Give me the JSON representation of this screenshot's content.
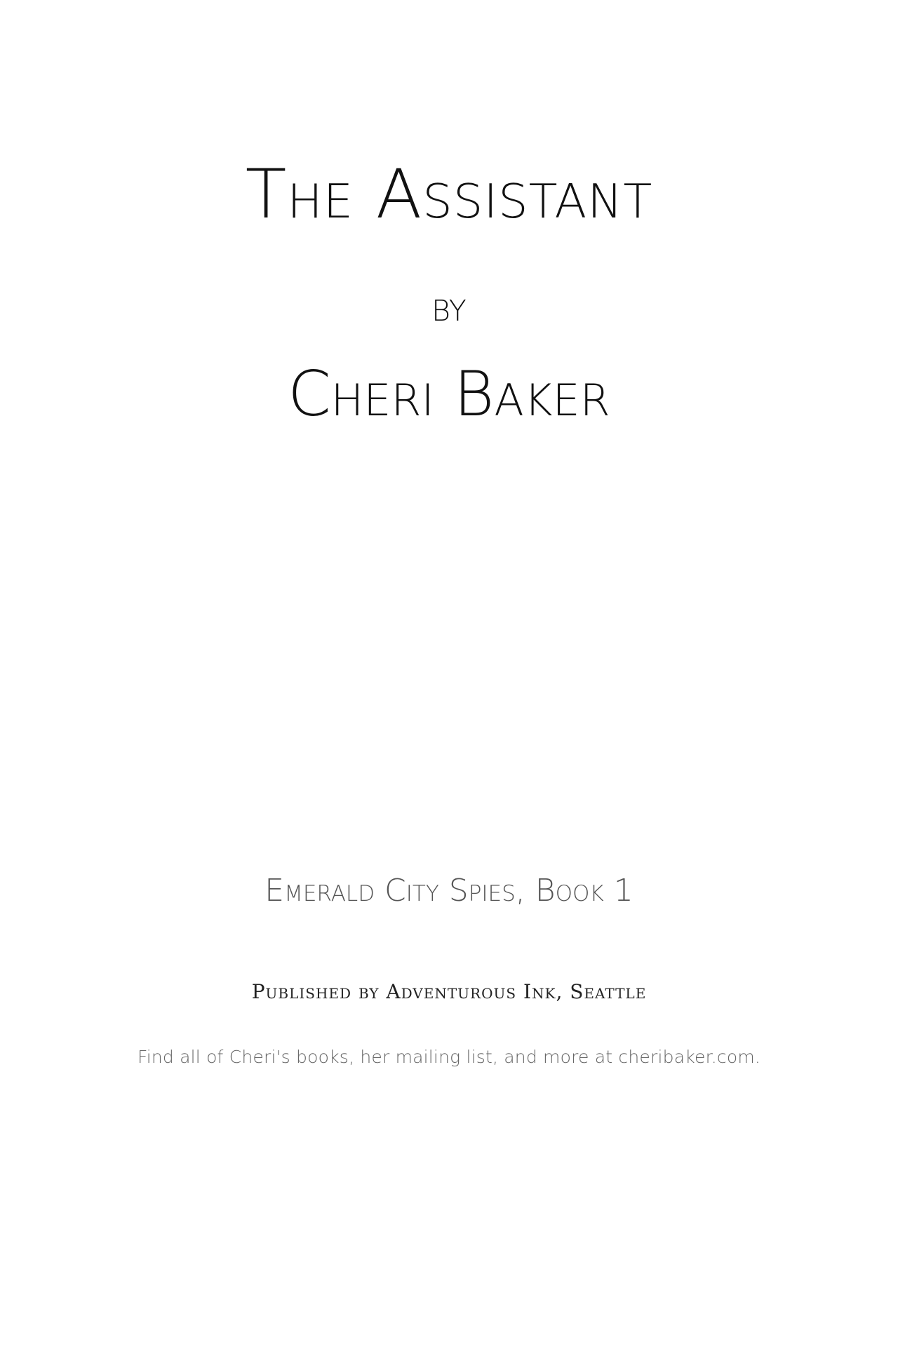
{
  "title_page": {
    "title": "The Assistant",
    "by": "by",
    "author": "Cheri Baker",
    "series": "Emerald City Spies, Book 1",
    "publisher": "Published by Adventurous Ink, Seattle",
    "website_note": "Find all of Cheri's books, her mailing list, and more at cheribaker.com."
  }
}
